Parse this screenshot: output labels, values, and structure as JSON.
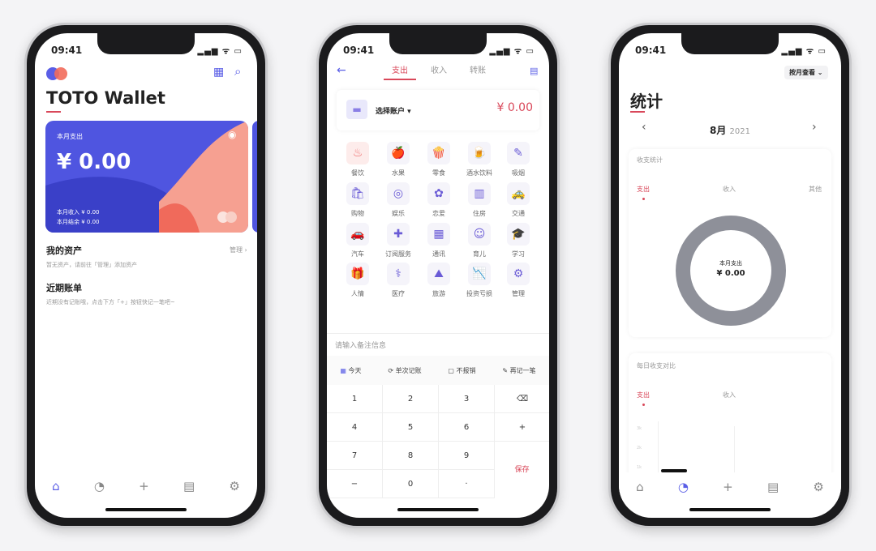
{
  "status": {
    "time": "09:41",
    "icons": "▂▄▆ ᯤ ▭"
  },
  "tabbar": [
    {
      "icon": "home-icon",
      "glyph": "⌂"
    },
    {
      "icon": "chart-icon",
      "glyph": "◔"
    },
    {
      "icon": "plus-icon",
      "glyph": "+"
    },
    {
      "icon": "calculator-icon",
      "glyph": "▤"
    },
    {
      "icon": "settings-icon",
      "glyph": "⚙"
    }
  ],
  "wallet": {
    "title": "TOTO Wallet",
    "card": {
      "label": "本月支出",
      "amount": "¥ 0.00",
      "income": "本月收入 ¥ 0.00",
      "balance": "本月结余 ¥ 0.00"
    },
    "assets_title": "我的资产",
    "assets_manage": "管理",
    "assets_empty": "暂无资产，请前往「管理」添加资产",
    "recent_title": "近期账单",
    "recent_empty": "近期没有记账哦，点击下方「+」按钮快记一笔吧~"
  },
  "entry": {
    "tabs": [
      "支出",
      "收入",
      "转账"
    ],
    "account": "选择账户 ▾",
    "amount": "¥ 0.00",
    "categories": [
      "餐饮",
      "水果",
      "零食",
      "酒水饮料",
      "吸烟",
      "购物",
      "娱乐",
      "恋爱",
      "住房",
      "交通",
      "汽车",
      "订阅服务",
      "通讯",
      "育儿",
      "学习",
      "人情",
      "医疗",
      "旅游",
      "投资亏损",
      "管理"
    ],
    "category_glyphs": [
      "♨",
      "🍎",
      "🍿",
      "🍺",
      "✎",
      "🛍",
      "◎",
      "✿",
      "▥",
      "🚕",
      "🚗",
      "✚",
      "▦",
      "☺",
      "🎓",
      "🎁",
      "⚕",
      "⛰",
      "📉",
      "⚙"
    ],
    "note_placeholder": "请输入备注信息",
    "options": [
      "今天",
      "单次记账",
      "不报销",
      "再记一笔"
    ],
    "keys": [
      "1",
      "2",
      "3",
      "⌫",
      "4",
      "5",
      "6",
      "+",
      "7",
      "8",
      "9",
      "",
      "−",
      "0",
      "·",
      ""
    ],
    "save": "保存"
  },
  "stats": {
    "view_mode": "按月查看",
    "title": "统计",
    "month": "8月",
    "year": "2021",
    "summary_title": "收支统计",
    "summary_tabs": [
      "支出",
      "收入",
      "其他"
    ],
    "donut_label": "本月支出",
    "donut_value": "¥ 0.00",
    "daily_title": "每日收支对比",
    "daily_tabs": [
      "支出",
      "收入"
    ],
    "y_ticks": [
      "3k",
      "2k",
      "1k"
    ]
  },
  "colors": {
    "accent": "#d9485a",
    "card": "#4f55e0",
    "purple": "#6a5bd6",
    "donut": "#8e9099"
  }
}
